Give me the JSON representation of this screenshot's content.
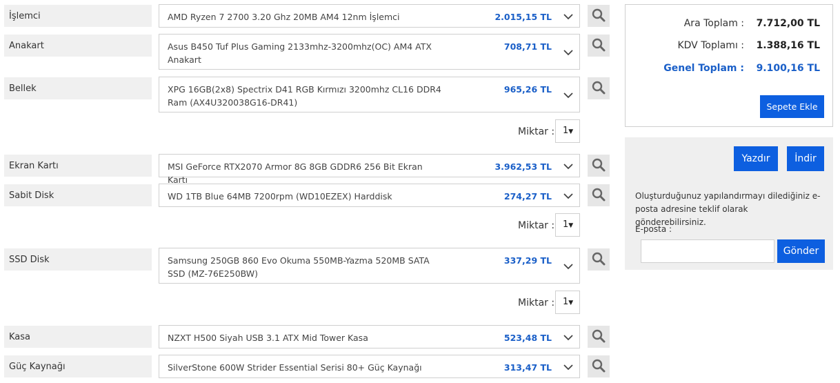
{
  "components": [
    {
      "category": "İşlemci",
      "product": "AMD Ryzen 7 2700 3.20 Ghz 20MB AM4 12nm İşlemci",
      "price": "2.015,15 TL"
    },
    {
      "category": "Anakart",
      "product": "Asus B450 Tuf Plus Gaming 2133mhz-3200mhz(OC) AM4 ATX Anakart",
      "price": "708,71 TL"
    },
    {
      "category": "Bellek",
      "product": "XPG 16GB(2x8) Spectrix D41 RGB Kırmızı 3200mhz CL16 DDR4 Ram (AX4U320038G16-DR41)",
      "price": "965,26 TL",
      "quantity": "1"
    },
    {
      "category": "Ekran Kartı",
      "product": "MSI GeForce RTX2070 Armor 8G 8GB GDDR6 256 Bit Ekran Kartı",
      "price": "3.962,53 TL"
    },
    {
      "category": "Sabit Disk",
      "product": "WD 1TB Blue 64MB 7200rpm (WD10EZEX) Harddisk",
      "price": "274,27 TL",
      "quantity": "1"
    },
    {
      "category": "SSD Disk",
      "product": "Samsung 250GB 860 Evo Okuma 550MB-Yazma 520MB SATA SSD (MZ-76E250BW)",
      "price": "337,29 TL",
      "quantity": "1"
    },
    {
      "category": "Kasa",
      "product": "NZXT H500 Siyah USB 3.1 ATX Mid Tower Kasa",
      "price": "523,48 TL"
    },
    {
      "category": "Güç Kaynağı",
      "product": "SilverStone 600W Strider Essential Serisi 80+ Güç Kaynağı",
      "price": "313,47 TL"
    }
  ],
  "quantity_label": "Miktar :",
  "totals": {
    "subtotal_label": "Ara Toplam :",
    "subtotal": "7.712,00 TL",
    "vat_label": "KDV Toplamı :",
    "vat": "1.388,16 TL",
    "grand_label": "Genel Toplam :",
    "grand": "9.100,16 TL",
    "add_to_cart": "Sepete Ekle"
  },
  "actions": {
    "print": "Yazdır",
    "download": "İndir",
    "note": "Oluşturduğunuz yapılandırmayı dilediğiniz e-posta adresine teklif olarak gönderebilirsiniz.",
    "email_label": "E-posta :",
    "email_value": "",
    "send": "Gönder"
  },
  "colors": {
    "accent": "#0d5fe0",
    "price": "#1a5fc8"
  },
  "icons": {
    "search": "search-icon",
    "dropdown": "chevron-down-icon"
  }
}
